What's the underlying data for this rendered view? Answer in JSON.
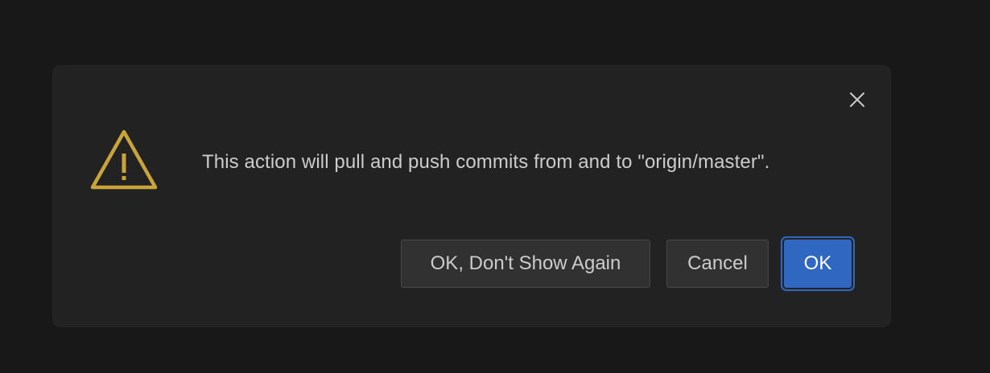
{
  "dialog": {
    "message": "This action will pull and push commits from and to \"origin/master\".",
    "icon": "warning-icon",
    "close_icon": "close-icon",
    "buttons": {
      "dont_show_again": "OK, Don't Show Again",
      "cancel": "Cancel",
      "ok": "OK"
    }
  },
  "colors": {
    "background": "#181818",
    "dialog_background": "#222222",
    "warning": "#c9a43b",
    "primary_button": "#2f67c1",
    "secondary_button": "#313131",
    "text": "#cccccc"
  }
}
